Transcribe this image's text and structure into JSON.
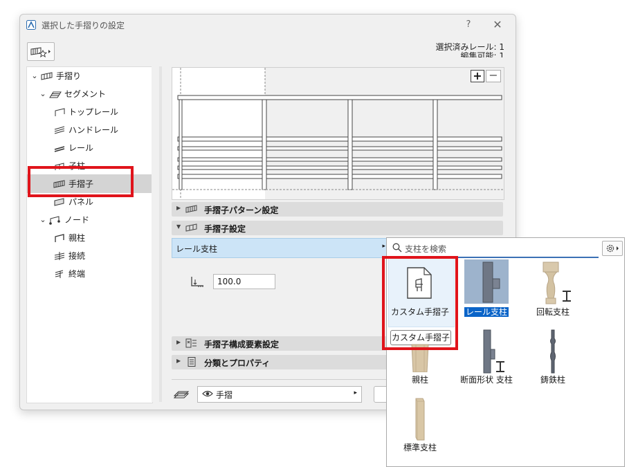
{
  "window": {
    "title": "選択した手摺りの設定",
    "help": "?",
    "close": "✕",
    "selection_info_line1": "選択済みレール: 1",
    "selection_info_line2": "編集可能: 1"
  },
  "tree": {
    "items": [
      {
        "label": "手摺り",
        "icon": "railing-icon",
        "level": 0,
        "expanded": true
      },
      {
        "label": "セグメント",
        "icon": "segment-icon",
        "level": 1,
        "expanded": true
      },
      {
        "label": "トップレール",
        "icon": "top-rail-icon",
        "level": 2
      },
      {
        "label": "ハンドレール",
        "icon": "handrail-icon",
        "level": 2
      },
      {
        "label": "レール",
        "icon": "rail-icon",
        "level": 2
      },
      {
        "label": "子柱",
        "icon": "inner-post-icon",
        "level": 2
      },
      {
        "label": "手摺子",
        "icon": "baluster-icon",
        "level": 2,
        "selected": true
      },
      {
        "label": "パネル",
        "icon": "panel-icon",
        "level": 2
      },
      {
        "label": "ノード",
        "icon": "node-icon",
        "level": 1,
        "expanded": true
      },
      {
        "label": "親柱",
        "icon": "post-icon",
        "level": 2
      },
      {
        "label": "接続",
        "icon": "connection-icon",
        "level": 2
      },
      {
        "label": "終端",
        "icon": "end-icon",
        "level": 2
      }
    ]
  },
  "preview": {
    "zoom_in": "+",
    "zoom_out": "−"
  },
  "sections": {
    "pattern": "手摺子パターン設定",
    "settings": "手摺子設定",
    "components": "手摺子構成要素設定",
    "classification": "分類とプロパティ"
  },
  "baluster_type": {
    "label": "レール支柱",
    "arrow": "▸"
  },
  "dimension": {
    "value": "100.0"
  },
  "layer": {
    "value": "手摺",
    "arrow": "▸"
  },
  "popup": {
    "search_placeholder": "支柱を検索",
    "items": [
      {
        "label": "カスタム手摺子",
        "icon": "custom-file-icon"
      },
      {
        "label": "レール支柱",
        "icon": "rail-post-icon",
        "selected": true
      },
      {
        "label": "回転支柱",
        "icon": "turned-post-icon"
      },
      {
        "label": "親柱",
        "icon": "newel-post-icon"
      },
      {
        "label": "断面形状 支柱",
        "icon": "profile-post-icon"
      },
      {
        "label": "鋳鉄柱",
        "icon": "cast-iron-post-icon"
      },
      {
        "label": "標準支柱",
        "icon": "standard-post-icon"
      }
    ],
    "tooltip": "カスタム手摺子"
  },
  "colors": {
    "highlight": "#e0141b",
    "selection_blue": "#cce4f7",
    "accent": "#0a64c8"
  }
}
